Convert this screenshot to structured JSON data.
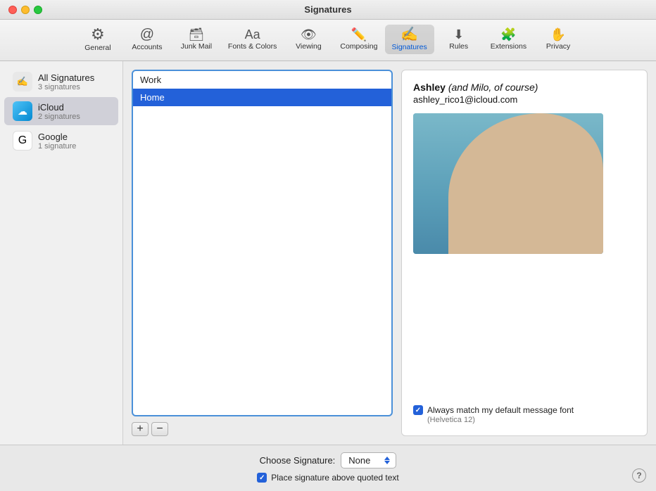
{
  "window": {
    "title": "Signatures"
  },
  "toolbar": {
    "items": [
      {
        "id": "general",
        "label": "General",
        "icon": "⚙",
        "active": false
      },
      {
        "id": "accounts",
        "label": "Accounts",
        "icon": "@",
        "active": false
      },
      {
        "id": "junkmail",
        "label": "Junk Mail",
        "icon": "🗂",
        "active": false
      },
      {
        "id": "fonts-colors",
        "label": "Fonts & Colors",
        "icon": "Aa",
        "active": false
      },
      {
        "id": "viewing",
        "label": "Viewing",
        "icon": "◉◉",
        "active": false
      },
      {
        "id": "composing",
        "label": "Composing",
        "icon": "✏",
        "active": false
      },
      {
        "id": "signatures",
        "label": "Signatures",
        "icon": "✍",
        "active": true
      },
      {
        "id": "rules",
        "label": "Rules",
        "icon": "↓",
        "active": false
      },
      {
        "id": "extensions",
        "label": "Extensions",
        "icon": "⚙",
        "active": false
      },
      {
        "id": "privacy",
        "label": "Privacy",
        "icon": "✋",
        "active": false
      }
    ]
  },
  "sidebar": {
    "items": [
      {
        "id": "all-signatures",
        "label": "All Signatures",
        "count": "3 signatures",
        "type": "all"
      },
      {
        "id": "icloud",
        "label": "iCloud",
        "count": "2 signatures",
        "type": "icloud"
      },
      {
        "id": "google",
        "label": "Google",
        "count": "1 signature",
        "type": "google"
      }
    ]
  },
  "signatures_list": {
    "items": [
      {
        "id": "work",
        "label": "Work",
        "selected": false
      },
      {
        "id": "home",
        "label": "Home",
        "selected": true
      }
    ]
  },
  "controls": {
    "add_label": "+",
    "remove_label": "−"
  },
  "preview": {
    "name_bold": "Ashley",
    "name_italic_part": "and Milo, of course",
    "email": "ashley_rico1@icloud.com",
    "font_match_label": "Always match my default message font",
    "font_hint": "(Helvetica 12)"
  },
  "bottom": {
    "choose_signature_label": "Choose Signature:",
    "choose_signature_value": "None",
    "place_signature_label": "Place signature above quoted text",
    "help_label": "?"
  }
}
